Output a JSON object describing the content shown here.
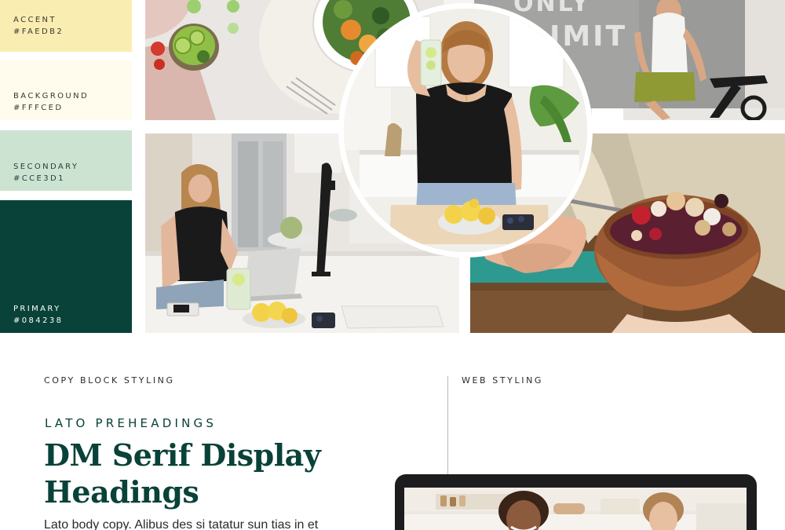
{
  "palette": {
    "accent": {
      "name": "ACCENT",
      "hex": "#FAEDB2",
      "color": "#FAEDB2",
      "text_color": "#3a3a2a"
    },
    "background": {
      "name": "BACKGROUND",
      "hex": "#FFFCED",
      "color": "#FFFCED",
      "text_color": "#3a3a2a"
    },
    "secondary": {
      "name": "SECONDARY",
      "hex": "#CCE3D1",
      "color": "#CCE3D1",
      "text_color": "#24413a"
    },
    "primary": {
      "name": "PRIMARY",
      "hex": "#084238",
      "color": "#084238",
      "text_color": "#ffffff"
    }
  },
  "photos": {
    "top_left": "salad-bowl-photo",
    "top_right": "gym-bike-photo",
    "bottom_left": "kitchen-laptop-photo",
    "bottom_right": "acai-bowl-photo",
    "center": "woman-holding-water-photo"
  },
  "gym_wall_text": [
    "ONLY",
    "LIMIT"
  ],
  "copy_block": {
    "label": "COPY BLOCK STYLING",
    "preheading": "LATO PREHEADINGS",
    "heading_line1": "DM Serif Display",
    "heading_line2": "Headings",
    "body": "Lato body copy. Alibus des si tatatur sun tias in et"
  },
  "web_styling": {
    "label": "WEB STYLING"
  }
}
